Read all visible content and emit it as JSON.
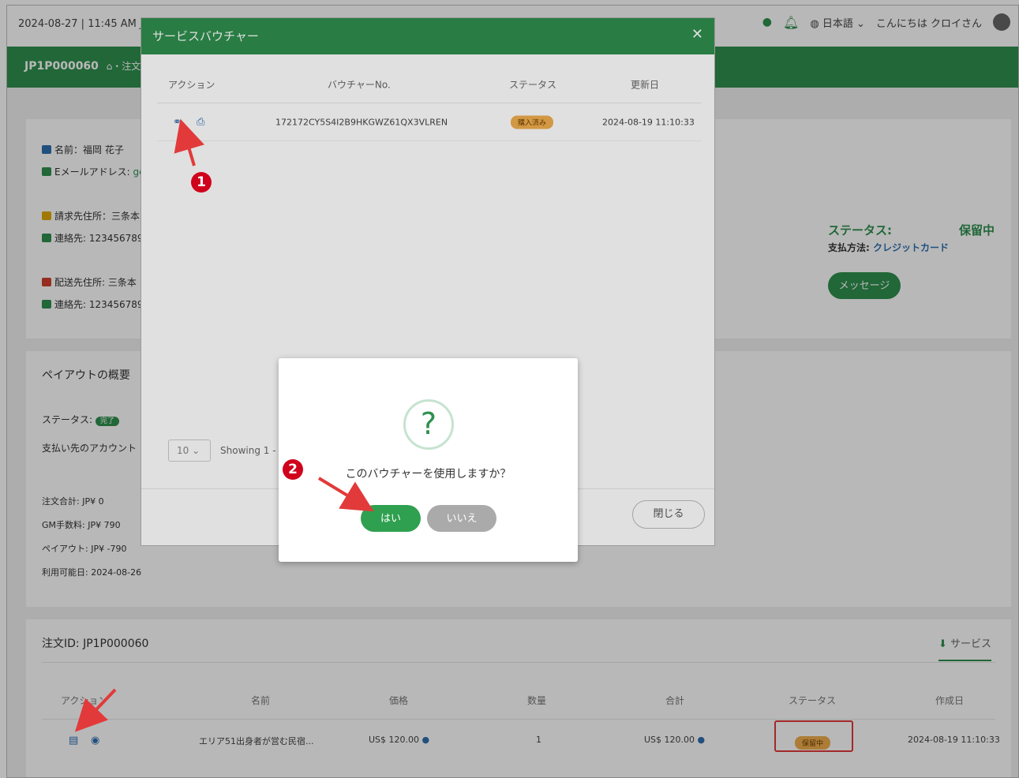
{
  "topbar": {
    "datetime": "2024-08-27 | 11:45 AM J",
    "language": "日本語",
    "greeting": "こんにちは クロイさん"
  },
  "breadcrumb": {
    "order_id": "JP1P000060",
    "home_sep": "⌂・注文"
  },
  "customer": {
    "name": "名前：福岡 花子",
    "email_label": "Eメールアドレス:",
    "email_value": "gc",
    "billing": "請求先住所：三条本",
    "contact1": "連絡先: 123456789",
    "shipping": "配送先住所: 三条本",
    "contact2": "連絡先: 123456789"
  },
  "order_status": {
    "label": "ステータス:",
    "value": "保留中",
    "payment_label": "支払方法:",
    "payment_value": "クレジットカード",
    "message_button": "メッセージ"
  },
  "payout": {
    "title": "ペイアウトの概要",
    "status_label": "ステータス:",
    "status_value": "完了",
    "account_label": "支払い先のアカウント",
    "order_total": "注文合計: JP¥ 0",
    "gm_fee": "GM手数料: JP¥ 790",
    "payout_amount": "ペイアウト: JP¥ -790",
    "available_date": "利用可能日: 2024-08-26"
  },
  "order_items": {
    "title": "注文ID: JP1P000060",
    "service_tab": "サービス",
    "headers": [
      "アクション",
      "名前",
      "価格",
      "数量",
      "合計",
      "ステータス",
      "作成日"
    ],
    "row": {
      "name": "エリア51出身者が営む民宿...",
      "price": "US$ 120.00",
      "qty": "1",
      "total": "US$ 120.00",
      "status": "保留中",
      "created": "2024-08-19 11:10:33"
    }
  },
  "voucher_modal": {
    "title": "サービスバウチャー",
    "headers": [
      "アクション",
      "バウチャーNo.",
      "ステータス",
      "更新日"
    ],
    "row": {
      "voucher_no": "172172CY5S4I2B9HKGWZ61QX3VLREN",
      "status": "購入済み",
      "updated": "2024-08-19 11:10:33"
    },
    "page_size": "10",
    "showing": "Showing 1 - 1",
    "close_button": "閉じる"
  },
  "confirm_dialog": {
    "icon": "?",
    "message": "このバウチャーを使用しますか？",
    "yes": "はい",
    "no": "いいえ"
  },
  "annotations": {
    "step1": "1",
    "step2": "2"
  },
  "colors": {
    "brand_green": "#2f8f4e",
    "badge_orange": "#f0ad4e",
    "annotation_red": "#d0021b"
  }
}
